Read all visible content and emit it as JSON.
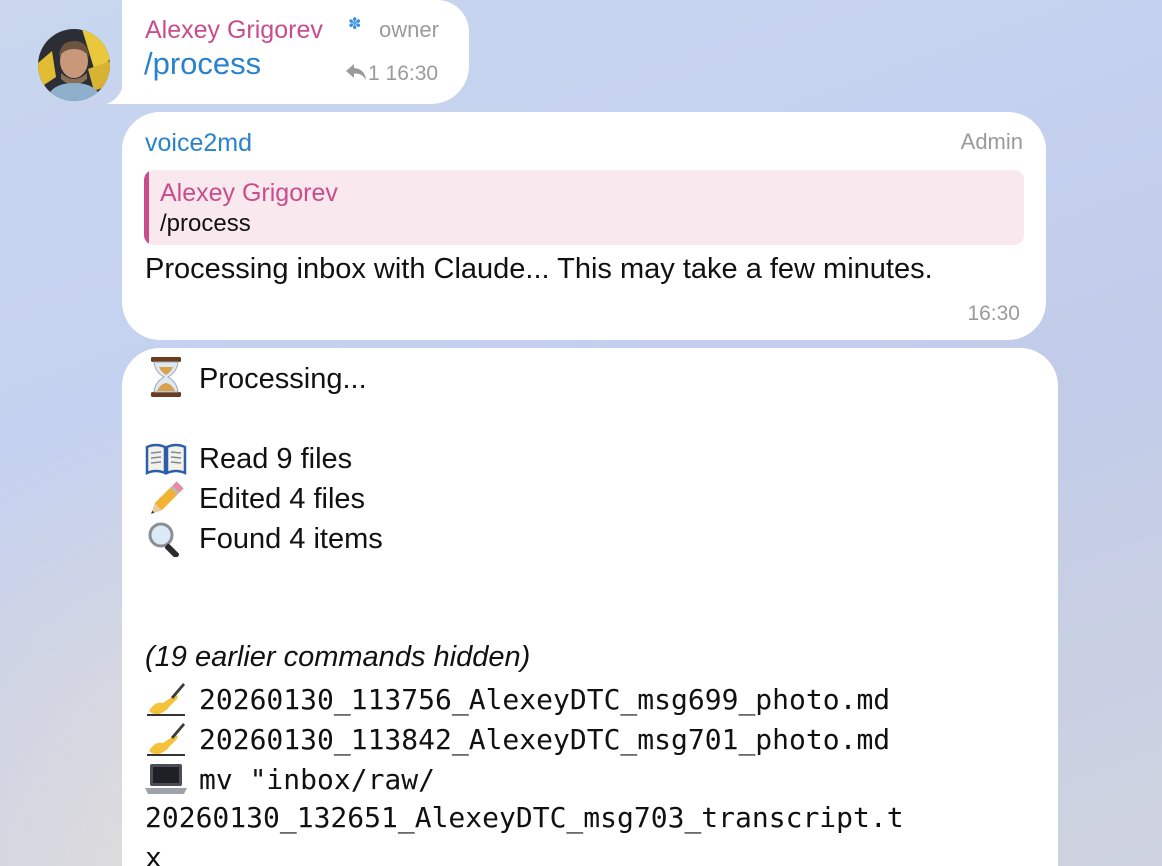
{
  "message1": {
    "sender": "Alexey Grigorev",
    "role": "owner",
    "text": "/process",
    "reply_count": "1",
    "time": "16:30",
    "icons": [
      "avatar",
      "star-badge-icon",
      "reply-arrow-icon"
    ]
  },
  "message2": {
    "sender": "voice2md",
    "role": "Admin",
    "quote": {
      "sender": "Alexey Grigorev",
      "text": "/process"
    },
    "text": "Processing inbox with Claude... This may take a few minutes.",
    "time": "16:30"
  },
  "message3": {
    "status": "Processing...",
    "stats": [
      {
        "icon": "open-book-icon",
        "text": "Read 9 files"
      },
      {
        "icon": "pencil-icon",
        "text": "Edited 4 files"
      },
      {
        "icon": "magnifier-icon",
        "text": "Found 4 items"
      }
    ],
    "hidden_note": "(19 earlier commands hidden)",
    "commands": [
      {
        "icon": "writing-hand-icon",
        "text": "20260130_113756_AlexeyDTC_msg699_photo.md"
      },
      {
        "icon": "writing-hand-icon",
        "text": "20260130_113842_AlexeyDTC_msg701_photo.md"
      },
      {
        "icon": "laptop-icon",
        "text": "mv \"inbox/raw/"
      }
    ],
    "continuation_1": "20260130_132651_AlexeyDTC_msg703_transcript.t",
    "continuation_2": "x"
  }
}
